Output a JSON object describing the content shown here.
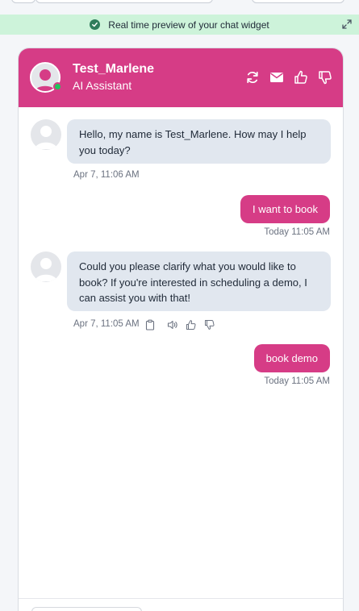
{
  "preview_bar": {
    "text": "Real time preview of your chat widget"
  },
  "header": {
    "bot_name": "Test_Marlene",
    "bot_role": "AI Assistant",
    "icons": [
      "refresh-icon",
      "mail-icon",
      "thumbs-up-icon",
      "thumbs-down-icon"
    ]
  },
  "messages": [
    {
      "sender": "bot",
      "lines": [
        "Hello, my name is Test_Marlene. How may I help",
        "you today?"
      ],
      "timestamp": "Apr 7, 11:06 AM"
    },
    {
      "sender": "user",
      "text": "I want to book",
      "timestamp": "Today 11:05 AM"
    },
    {
      "sender": "bot",
      "lines": [
        "Could you please clarify what you would like to",
        "book? If you're interested in scheduling a demo, I",
        "can assist you with that!"
      ],
      "timestamp": "Apr 7, 11:05 AM",
      "tools": [
        "clipboard-icon",
        "speaker-icon",
        "thumbs-up-icon",
        "thumbs-down-icon"
      ]
    },
    {
      "sender": "user",
      "text": "book demo",
      "timestamp": "Today 11:05 AM"
    }
  ],
  "colors": {
    "brand": "#d63c86",
    "bot_bubble": "#e1e7ef",
    "preview_bar": "#cdf3da",
    "online": "#22c55e"
  }
}
